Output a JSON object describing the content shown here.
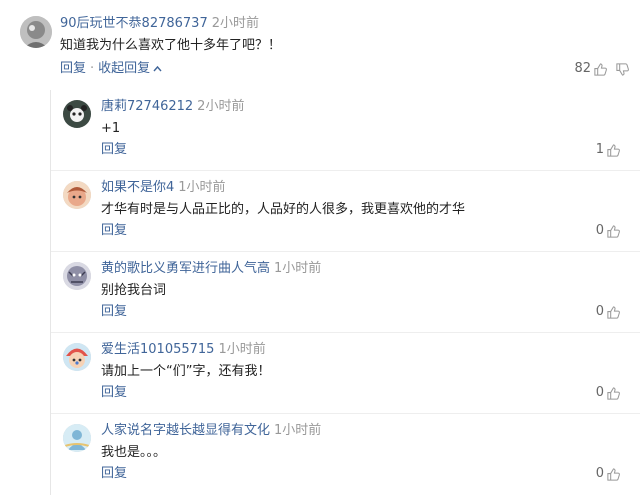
{
  "main": {
    "username": "90后玩世不恭82786737",
    "time": "2小时前",
    "text": "知道我为什么喜欢了他十多年了吧？！",
    "reply_label": "回复",
    "separator": "·",
    "collapse_label": "收起回复",
    "likes": "82"
  },
  "replies": [
    {
      "username": "唐莉72746212",
      "time": "2小时前",
      "text": "+1",
      "reply_label": "回复",
      "likes": "1"
    },
    {
      "username": "如果不是你4",
      "time": "1小时前",
      "text": "才华有时是与人品正比的，人品好的人很多，我更喜欢他的才华",
      "reply_label": "回复",
      "likes": "0"
    },
    {
      "username": "黄的歌比义勇军进行曲人气高",
      "time": "1小时前",
      "text": "别抢我台词",
      "reply_label": "回复",
      "likes": "0"
    },
    {
      "username": "爱生活101055715",
      "time": "1小时前",
      "text": "请加上一个“们”字，还有我！",
      "reply_label": "回复",
      "likes": "0"
    },
    {
      "username": "人家说名字越长越显得有文化",
      "time": "1小时前",
      "text": "我也是。。。",
      "reply_label": "回复",
      "likes": "0"
    }
  ],
  "icons": {
    "like": "thumbs-up-icon",
    "dislike": "thumbs-down-icon",
    "collapse": "chevron-up-icon"
  },
  "colors": {
    "username": "#406599",
    "action": "#406599",
    "time": "#999999",
    "text": "#222222"
  }
}
